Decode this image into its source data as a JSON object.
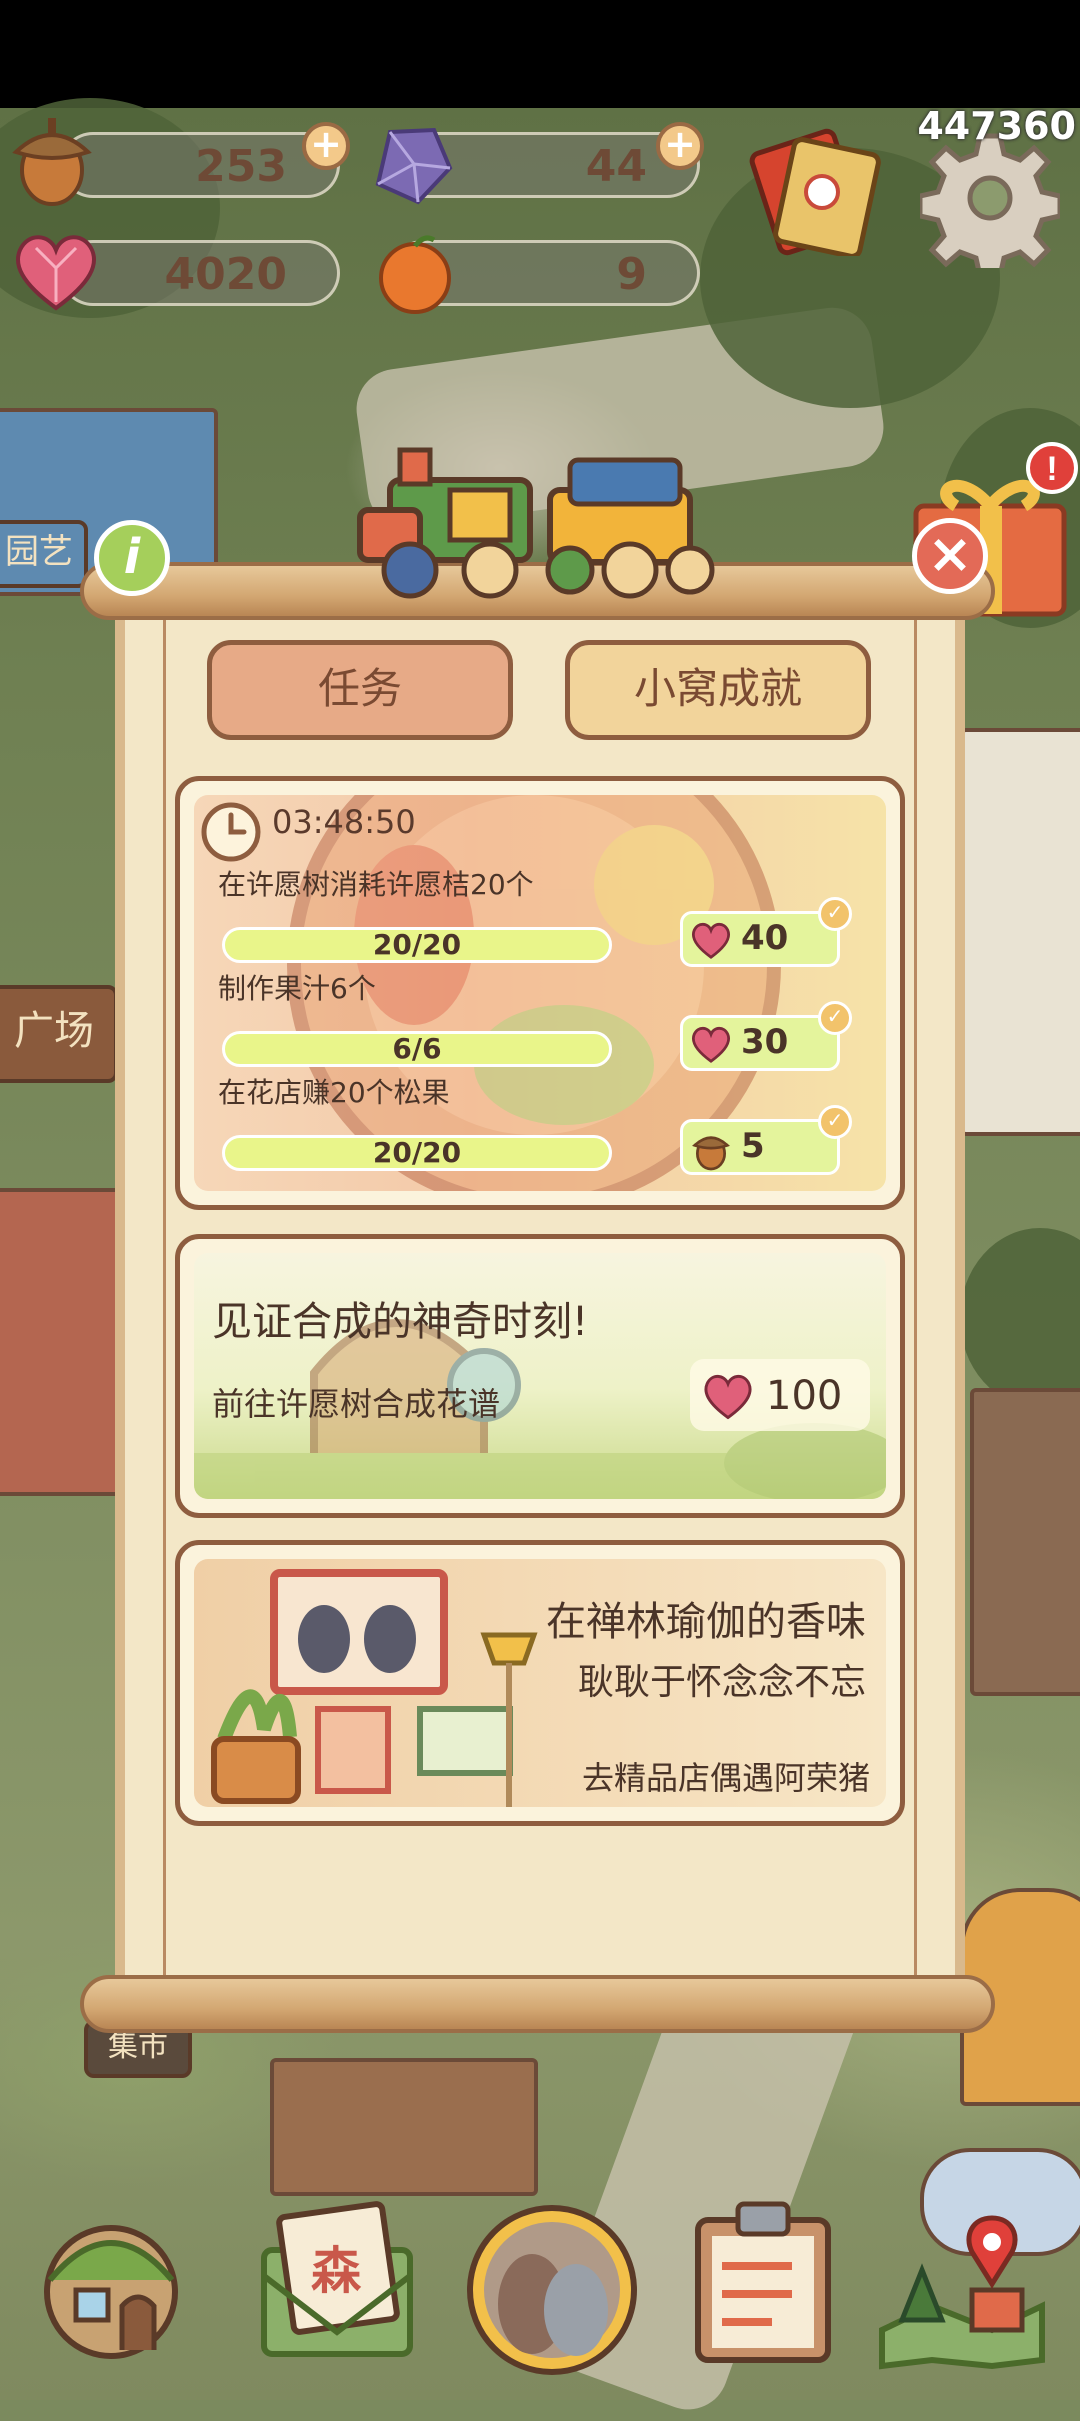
{
  "resources": {
    "acorns": "253",
    "gems": "44",
    "hearts": "4020",
    "fruit": "9",
    "score": "447360"
  },
  "scene_signs": {
    "garden": "园艺",
    "square": "广场",
    "market": "集市"
  },
  "tabs": [
    {
      "label": "任务",
      "active": true
    },
    {
      "label": "小窝成就",
      "active": false
    }
  ],
  "daily_tasks": {
    "timer": "03:48:50",
    "tasks": [
      {
        "text": "在许愿树消耗许愿桔20个",
        "progress": "20/20",
        "reward_icon": "heart-gem-icon",
        "reward": "40",
        "completed": true
      },
      {
        "text": "制作果汁6个",
        "progress": "6/6",
        "reward_icon": "heart-gem-icon",
        "reward": "30",
        "completed": true
      },
      {
        "text": "在花店赚20个松果",
        "progress": "20/20",
        "reward_icon": "acorn-icon",
        "reward": "5",
        "completed": true
      }
    ]
  },
  "achievement_card": {
    "title": "见证合成的神奇时刻!",
    "subtitle": "前往许愿树合成花谱",
    "reward_icon": "heart-gem-icon",
    "reward": "100"
  },
  "story_card": {
    "title": "在禅林瑜伽的香味",
    "subtitle": "耿耿于怀念念不忘",
    "link": "去精品店偶遇阿荣猪"
  },
  "bottom_nav": [
    "home-icon",
    "mail-icon",
    "friends-icon",
    "tasks-clipboard-icon",
    "map-icon"
  ],
  "colors": {
    "active_tab": "#e7aa87",
    "inactive_tab": "#f2d49b",
    "progress_bar": "#e9f58a",
    "close_button": "#e36a57",
    "info_button": "#a5cf5b"
  }
}
